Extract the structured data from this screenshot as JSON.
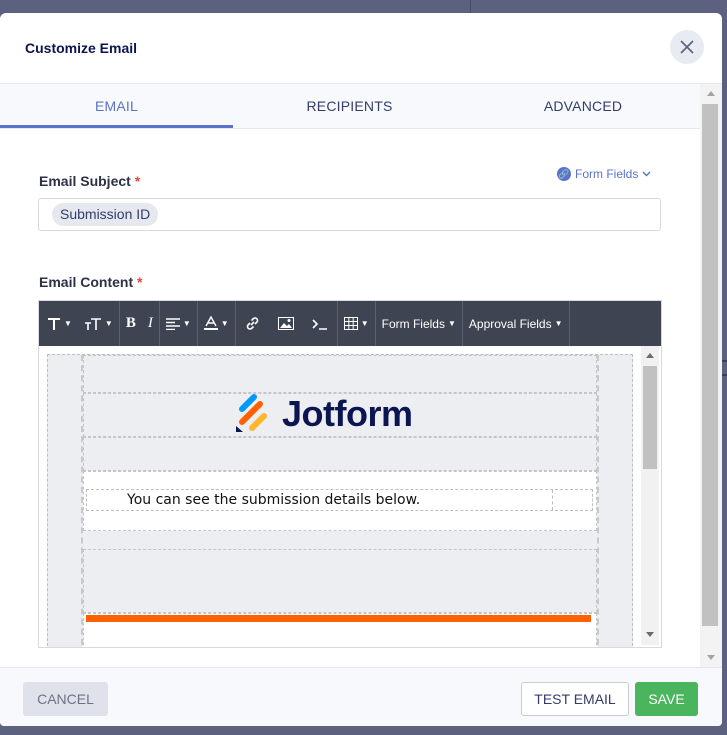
{
  "modal": {
    "title": "Customize Email",
    "close_icon": "close-icon"
  },
  "tabs": [
    {
      "label": "EMAIL",
      "active": true
    },
    {
      "label": "RECIPIENTS",
      "active": false
    },
    {
      "label": "ADVANCED",
      "active": false
    }
  ],
  "subject": {
    "label": "Email Subject",
    "required_mark": "*",
    "form_fields_link": "Form Fields",
    "tag": "Submission ID"
  },
  "content": {
    "label": "Email Content",
    "required_mark": "*",
    "toolbar": {
      "form_fields": "Form Fields",
      "approval_fields": "Approval Fields"
    },
    "logo_text": "Jotform",
    "body_text": "You can see the submission details below."
  },
  "footer": {
    "cancel": "CANCEL",
    "test_email": "TEST EMAIL",
    "save": "SAVE"
  },
  "colors": {
    "accent": "#5a72c9",
    "save": "#4ab55d",
    "brand_orange": "#ff6100",
    "toolbar_bg": "#3e4451"
  }
}
